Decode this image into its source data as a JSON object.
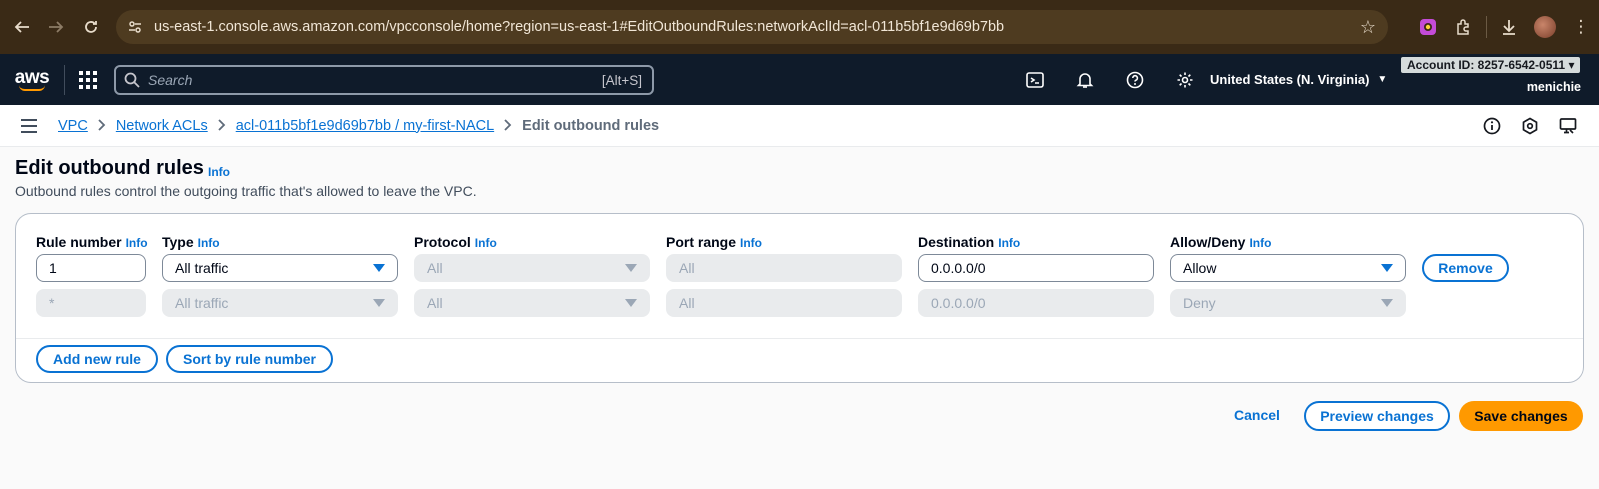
{
  "browser": {
    "url": "us-east-1.console.aws.amazon.com/vpcconsole/home?region=us-east-1#EditOutboundRules:networkAclId=acl-011b5bf1e9d69b7bb"
  },
  "aws_nav": {
    "logo_text": "aws",
    "search_placeholder": "Search",
    "search_shortcut": "[Alt+S]",
    "region": "United States (N. Virginia)",
    "account_id": "Account ID: 8257-6542-0511",
    "user": "menichie"
  },
  "breadcrumb": {
    "items": [
      "VPC",
      "Network ACLs",
      "acl-011b5bf1e9d69b7bb / my-first-NACL"
    ],
    "current": "Edit outbound rules"
  },
  "page": {
    "title": "Edit outbound rules",
    "info": "Info",
    "description": "Outbound rules control the outgoing traffic that's allowed to leave the VPC."
  },
  "columns": {
    "rule_number": "Rule number",
    "type": "Type",
    "protocol": "Protocol",
    "port_range": "Port range",
    "destination": "Destination",
    "allow_deny": "Allow/Deny",
    "info": "Info"
  },
  "rules": [
    {
      "rule_number": "1",
      "type": "All traffic",
      "protocol": "All",
      "port_range": "All",
      "destination": "0.0.0.0/0",
      "allow_deny": "Allow",
      "remove": "Remove"
    },
    {
      "rule_number": "*",
      "type": "All traffic",
      "protocol": "All",
      "port_range": "All",
      "destination": "0.0.0.0/0",
      "allow_deny": "Deny"
    }
  ],
  "container_buttons": {
    "add_rule": "Add new rule",
    "sort": "Sort by rule number"
  },
  "actions": {
    "cancel": "Cancel",
    "preview": "Preview changes",
    "save": "Save changes"
  },
  "colors": {
    "accent": "#0972d3",
    "primary_button": "#ff9900",
    "nav_bg": "#0f1b2a"
  }
}
